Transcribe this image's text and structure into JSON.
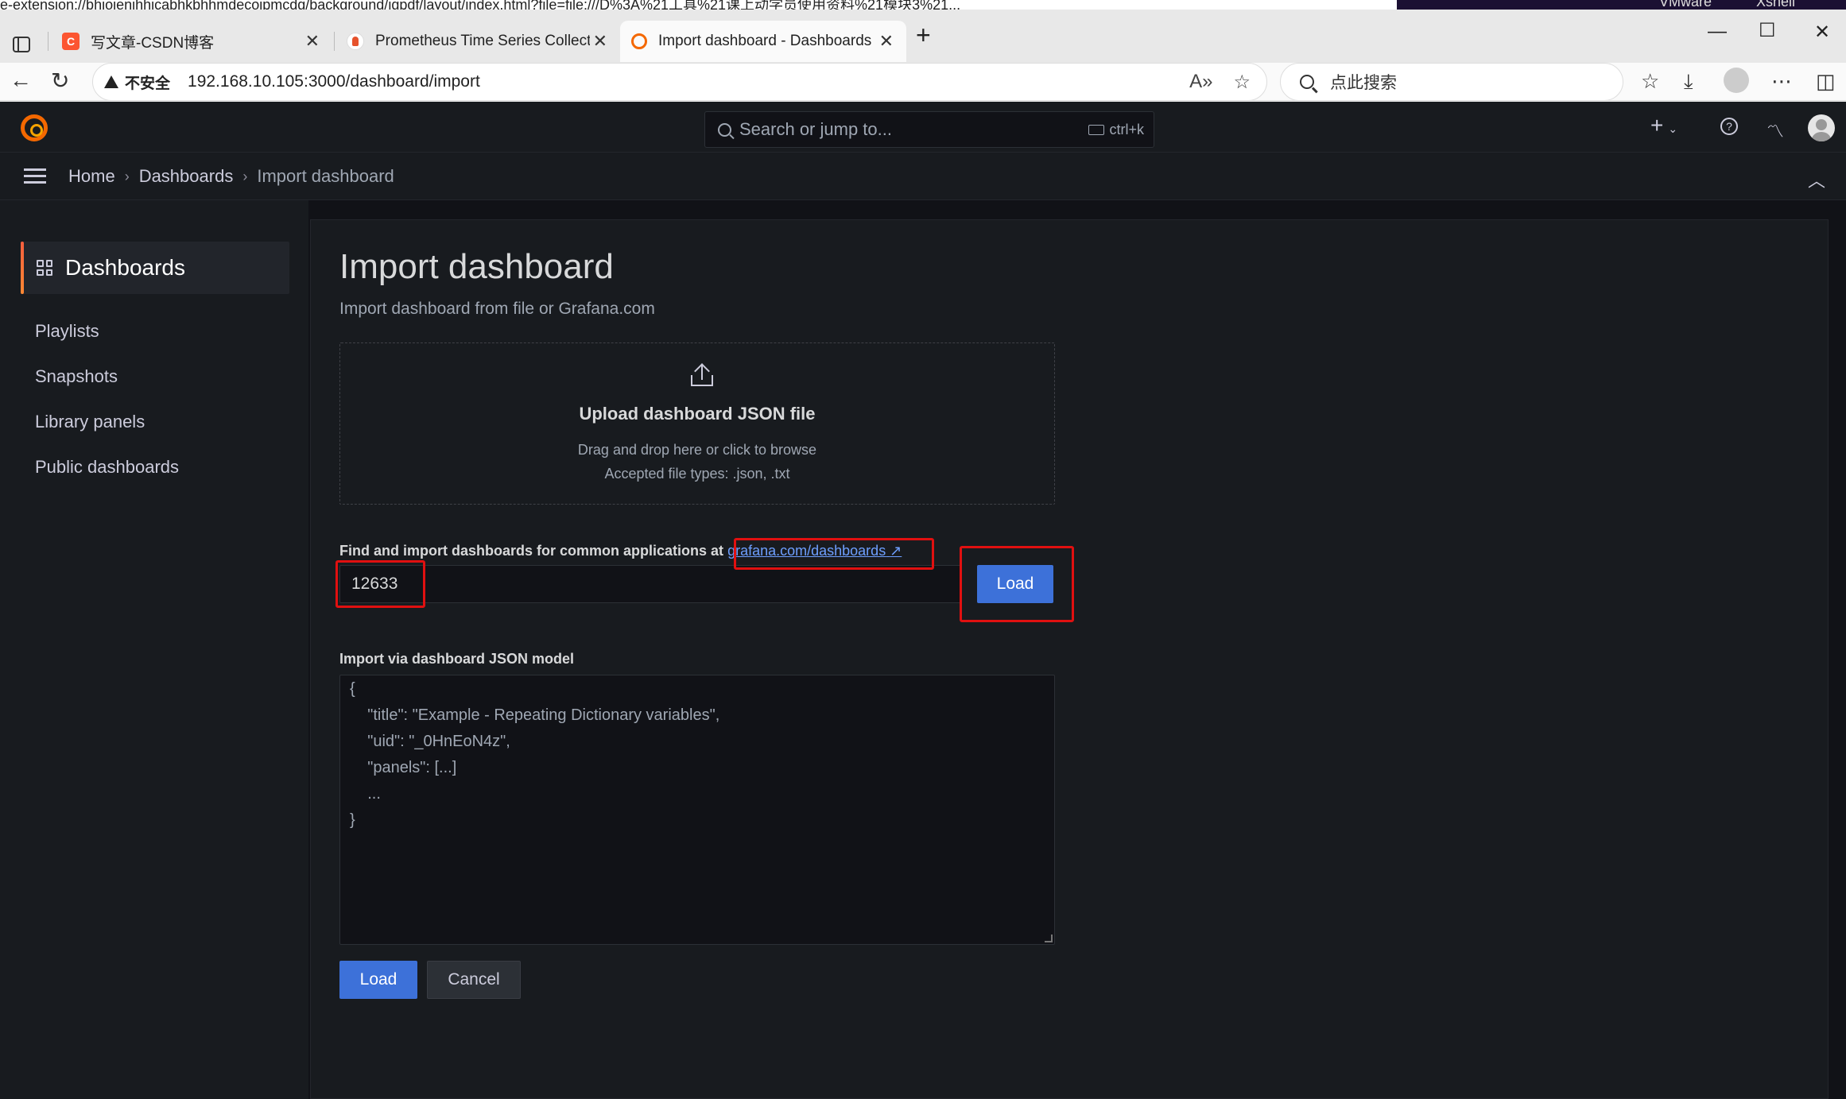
{
  "os": {
    "url_fragment": "e-extension://bhjoienjhhicabhkbhhmdecoipmcdg/background/jgpdf/layout/index.html?file=file:///D%3A%21工具%21课上动学员使用资料%21模块3%21...",
    "vmware": "VMware",
    "xshell": "Xshell"
  },
  "tabs": [
    {
      "label": "写文章-CSDN博客",
      "icon": "csdn-icon",
      "color": "#fc5531"
    },
    {
      "label": "Prometheus Time Series Collectio",
      "icon": "prometheus-icon",
      "color": "#e6522c"
    },
    {
      "label": "Import dashboard - Dashboards -",
      "icon": "grafana-icon",
      "color": "#f46800"
    }
  ],
  "browser": {
    "insecure_label": "不安全",
    "url": "192.168.10.105:3000/dashboard/import",
    "search_placeholder": "点此搜索",
    "new_tab": "+",
    "close": "✕",
    "minimize": "—",
    "maximize": "☐",
    "win_close": "✕"
  },
  "grafana": {
    "search_placeholder": "Search or jump to...",
    "search_shortcut": "ctrl+k",
    "add_label": "+",
    "breadcrumbs": [
      "Home",
      "Dashboards",
      "Import dashboard"
    ],
    "sidebar": {
      "section": "Dashboards",
      "items": [
        "Playlists",
        "Snapshots",
        "Library panels",
        "Public dashboards"
      ]
    },
    "page": {
      "title": "Import dashboard",
      "subtitle": "Import dashboard from file or Grafana.com",
      "upload_title": "Upload dashboard JSON file",
      "upload_desc1": "Drag and drop here or click to browse",
      "upload_desc2": "Accepted file types: .json, .txt",
      "find_label": "Find and import dashboards for common applications at",
      "find_link": "grafana.com/dashboards",
      "id_value": "12633",
      "load_label": "Load",
      "json_label": "Import via dashboard JSON model",
      "json_lines": [
        "{",
        "    \"title\": \"Example - Repeating Dictionary variables\",",
        "    \"uid\": \"_0HnEoN4z\",",
        "    \"panels\": [...]",
        "    ...",
        "}"
      ],
      "load_button": "Load",
      "cancel_button": "Cancel"
    }
  },
  "colors": {
    "accent": "#3d71d9",
    "annotation": "#e01010",
    "grafana_orange": "#f46800"
  }
}
